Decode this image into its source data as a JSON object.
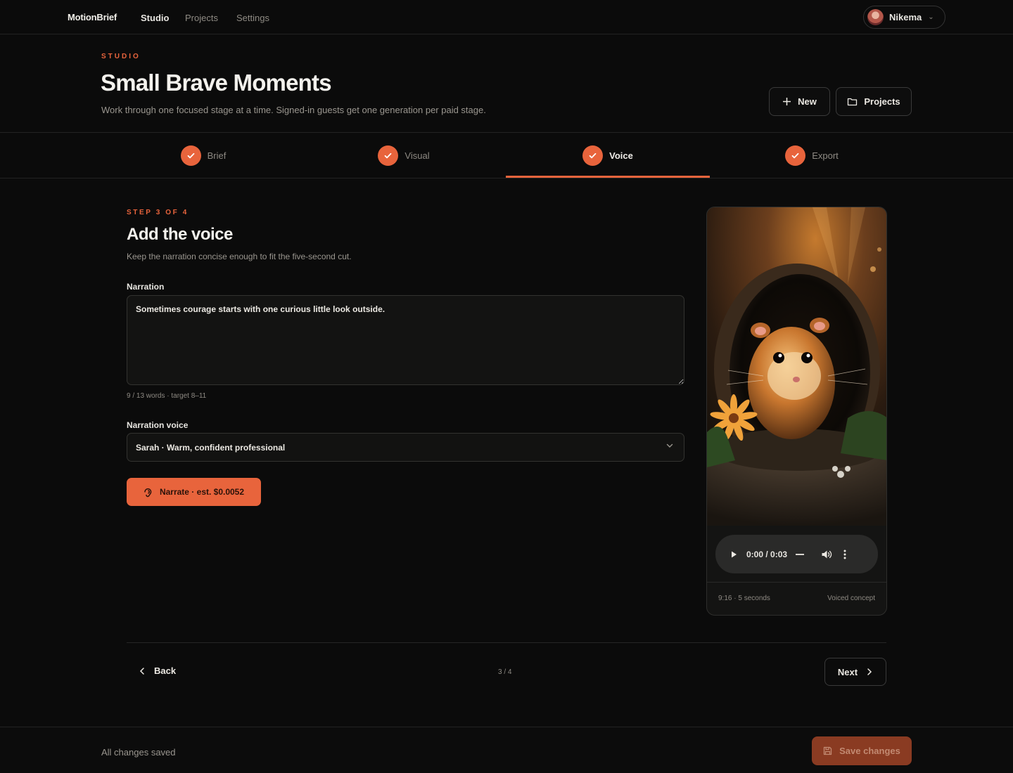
{
  "nav": {
    "brand": "MotionBrief",
    "links": [
      "Studio",
      "Projects",
      "Settings"
    ],
    "active": "Studio",
    "user": {
      "name": "Nikema"
    }
  },
  "header": {
    "eyebrow": "STUDIO",
    "title": "Small Brave Moments",
    "subtitle": "Work through one focused stage at a time. Signed-in guests get one generation per paid stage.",
    "new_label": "New",
    "projects_label": "Projects"
  },
  "stepper": {
    "steps": [
      {
        "label": "Brief",
        "done": true
      },
      {
        "label": "Visual",
        "done": true
      },
      {
        "label": "Voice",
        "done": true,
        "active": true
      },
      {
        "label": "Export",
        "done": true
      }
    ]
  },
  "form": {
    "step_count": "STEP 3 OF 4",
    "title": "Add the voice",
    "subtitle": "Keep the narration concise enough to fit the five-second cut.",
    "narration_label": "Narration",
    "narration_value": "Sometimes courage starts with one curious little look outside.",
    "word_count": "9 / 13 words · target 8–11",
    "voice_label": "Narration voice",
    "voice_value": "Sarah · Warm, confident professional",
    "narrate_label": "Narrate · est. $0.0052"
  },
  "preview": {
    "player_time": "0:00 / 0:03",
    "meta_left": "9:16 · 5 seconds",
    "meta_right": "Voiced concept"
  },
  "footer_nav": {
    "back_label": "Back",
    "progress": "3 / 4",
    "next_label": "Next"
  },
  "savebar": {
    "status": "All changes saved",
    "save_label": "Save changes"
  },
  "colors": {
    "accent": "#e8643c",
    "background": "#0b0b0b"
  }
}
